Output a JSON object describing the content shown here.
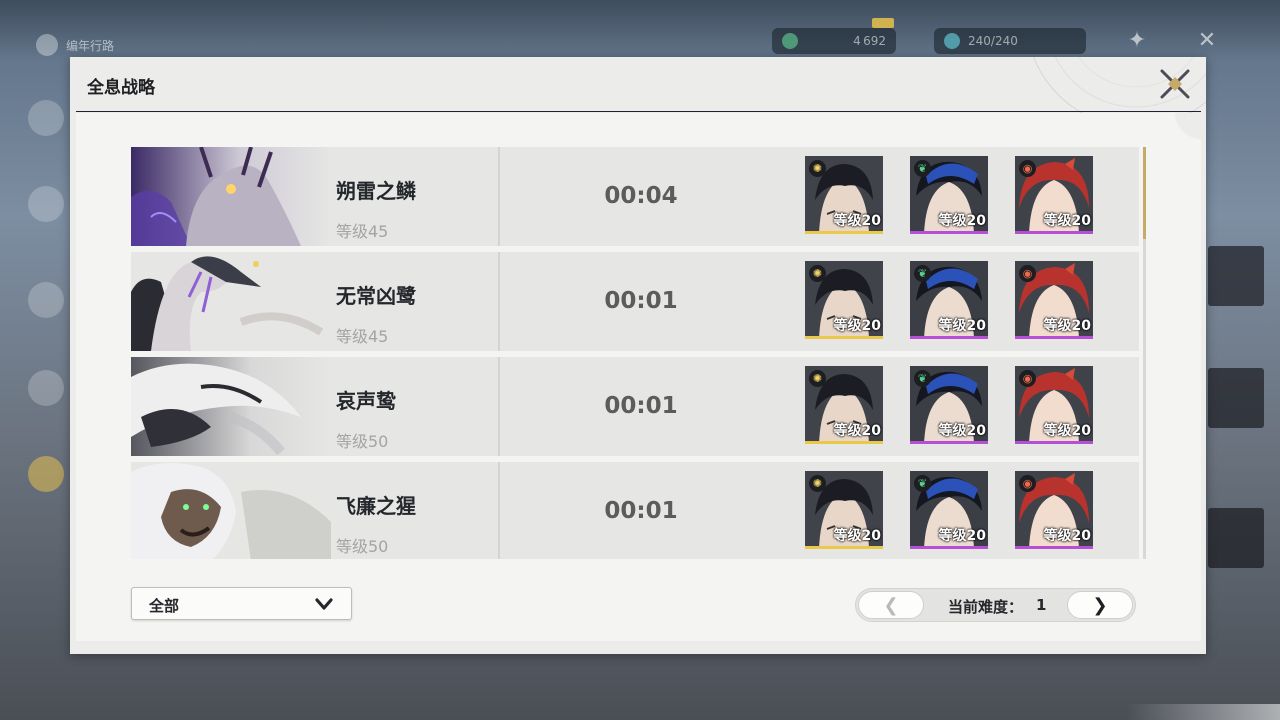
{
  "background": {
    "menu_title": "编年行路",
    "currency_value": "4 692",
    "stamina_value": "240/240"
  },
  "panel": {
    "title": "全息战略"
  },
  "records": [
    {
      "boss_name": "朔雷之鳞",
      "level": "等级45",
      "clear_time": "00:04",
      "team": [
        {
          "element": "spectro",
          "level": "等级20",
          "rarity": "gold"
        },
        {
          "element": "aero",
          "level": "等级20",
          "rarity": "purple"
        },
        {
          "element": "fusion",
          "level": "等级20",
          "rarity": "purple"
        }
      ]
    },
    {
      "boss_name": "无常凶鹭",
      "level": "等级45",
      "clear_time": "00:01",
      "team": [
        {
          "element": "spectro",
          "level": "等级20",
          "rarity": "gold"
        },
        {
          "element": "aero",
          "level": "等级20",
          "rarity": "purple"
        },
        {
          "element": "fusion",
          "level": "等级20",
          "rarity": "purple"
        }
      ]
    },
    {
      "boss_name": "哀声鸷",
      "level": "等级50",
      "clear_time": "00:01",
      "team": [
        {
          "element": "spectro",
          "level": "等级20",
          "rarity": "gold"
        },
        {
          "element": "aero",
          "level": "等级20",
          "rarity": "purple"
        },
        {
          "element": "fusion",
          "level": "等级20",
          "rarity": "purple"
        }
      ]
    },
    {
      "boss_name": "飞廉之猩",
      "level": "等级50",
      "clear_time": "00:01",
      "team": [
        {
          "element": "spectro",
          "level": "等级20",
          "rarity": "gold"
        },
        {
          "element": "aero",
          "level": "等级20",
          "rarity": "purple"
        },
        {
          "element": "fusion",
          "level": "等级20",
          "rarity": "purple"
        }
      ]
    }
  ],
  "filter": {
    "selected": "全部"
  },
  "pager": {
    "label": "当前难度：",
    "value": "1",
    "prev_icon": "chevron-left",
    "next_icon": "chevron-right"
  },
  "colors": {
    "gold_rarity": "#e9c84a",
    "purple_rarity": "#b64fd6",
    "accent_gold": "#c7a96a"
  }
}
